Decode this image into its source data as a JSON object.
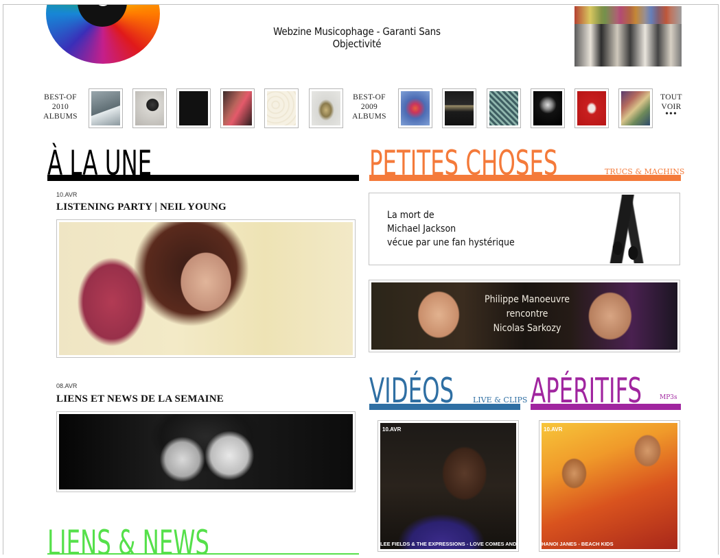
{
  "header": {
    "tagline": "Webzine Musicophage - Garanti Sans Objectivité"
  },
  "strip": {
    "best2010_label": "BEST-OF\n2010\nALBUMS",
    "best2010_lines": [
      "BEST-OF",
      "2010",
      "ALBUMS"
    ],
    "best2009_lines": [
      "BEST-OF",
      "2009",
      "ALBUMS"
    ],
    "tout_voir_lines": [
      "TOUT",
      "VOIR"
    ],
    "tout_voir_more": "•••"
  },
  "a_la_une": {
    "title": "À LA UNE",
    "articles": [
      {
        "date": "10.AVR",
        "title": "LISTENING PARTY | NEIL YOUNG"
      },
      {
        "date": "08.AVR",
        "title": "LIENS ET NEWS DE LA SEMAINE"
      }
    ]
  },
  "petites_choses": {
    "title": "PETITES CHOSES",
    "subtitle": "TRUCS & MACHINS",
    "item1_lines": [
      "La mort de",
      "Michael Jackson",
      "vécue par une fan hystérique"
    ],
    "item2_lines": [
      "Philippe Manoeuvre",
      "rencontre",
      "Nicolas Sarkozy"
    ]
  },
  "videos": {
    "title": "VIDÉOS",
    "subtitle": "LIVE & CLIPS",
    "item": {
      "date": "10.AVR",
      "caption": "LEE FIELDS & THE EXPRESSIONS - LOVE COMES AND"
    }
  },
  "aperitifs": {
    "title": "APÉRITIFS",
    "subtitle": "MP3s",
    "item": {
      "date": "10.AVR",
      "caption": "HANOI JANES - BEACH KIDS"
    }
  },
  "liens_news": {
    "title": "LIENS & NEWS"
  },
  "colors": {
    "a_la_une": "#000000",
    "petites_choses": "#f47a3a",
    "videos": "#2f6fa3",
    "aperitifs": "#a0259f",
    "liens_news": "#55e04a"
  }
}
